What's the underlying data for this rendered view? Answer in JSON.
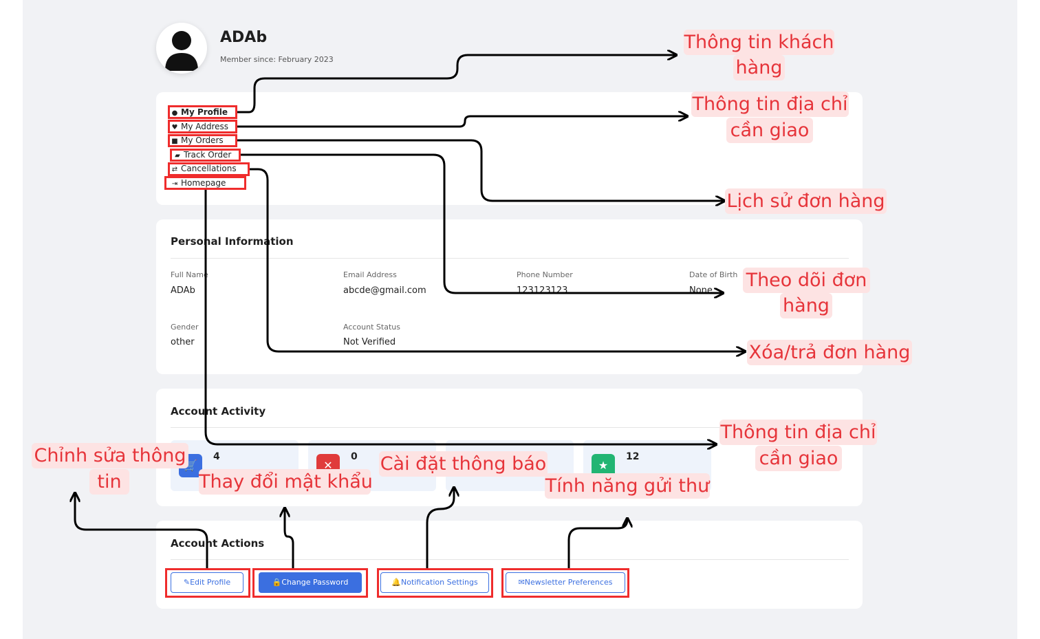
{
  "profile": {
    "name": "ADAb",
    "member_since": "Member since: February 2023"
  },
  "sidebar": {
    "items": [
      {
        "label": "My Profile",
        "icon": "user-circle-icon"
      },
      {
        "label": "My Address",
        "icon": "heart-icon"
      },
      {
        "label": "My Orders",
        "icon": "box-icon"
      },
      {
        "label": "Track Order",
        "icon": "truck-icon"
      },
      {
        "label": "Cancellations",
        "icon": "exchange-icon"
      },
      {
        "label": "Homepage",
        "icon": "sign-out-icon"
      }
    ]
  },
  "personal": {
    "title": "Personal Information",
    "full_name_label": "Full Name",
    "full_name": "ADAb",
    "email_label": "Email Address",
    "email": "abcde@gmail.com",
    "phone_label": "Phone Number",
    "phone": "123123123",
    "dob_label": "Date of Birth",
    "dob": "None",
    "gender_label": "Gender",
    "gender": "other",
    "status_label": "Account Status",
    "status": "Not Verified"
  },
  "activity": {
    "title": "Account Activity",
    "stats": [
      {
        "value": "4",
        "label": "",
        "icon": "cart-icon",
        "color": "#3b6fe0"
      },
      {
        "value": "0",
        "label": "",
        "icon": "x-icon",
        "color": "#e03b3b"
      },
      {
        "value": "",
        "label": "",
        "icon": "",
        "color": "#f5a524"
      },
      {
        "value": "12",
        "label": "",
        "icon": "star-icon",
        "color": "#22b573"
      }
    ]
  },
  "actions": {
    "title": "Account Actions",
    "edit_profile": "Edit Profile",
    "change_password": "Change Password",
    "notification_settings": "Notification Settings",
    "newsletter": "Newsletter Preferences"
  },
  "annotations": {
    "customer_info_1": "Thông tin khách",
    "customer_info_2": "hàng",
    "address_info_1": "Thông tin địa chỉ",
    "address_info_2": "cần giao",
    "order_history": "Lịch sử đơn hàng",
    "track_1": "Theo dõi đơn",
    "track_2": "hàng",
    "cancel": "Xóa/trả đơn hàng",
    "home_1": "Thông tin địa chỉ",
    "home_2": "cần giao",
    "edit_1": "Chỉnh sửa thông",
    "edit_2": "tin",
    "password": "Thay đổi mật khẩu",
    "notify": "Cài đặt thông báo",
    "newsletter": "Tính năng gửi thư"
  },
  "colors": {
    "accent": "#3b6fe0",
    "annotation_text": "#e6343a",
    "annotation_bg": "#fde3e3",
    "highlight_box": "#ef2c2c"
  }
}
